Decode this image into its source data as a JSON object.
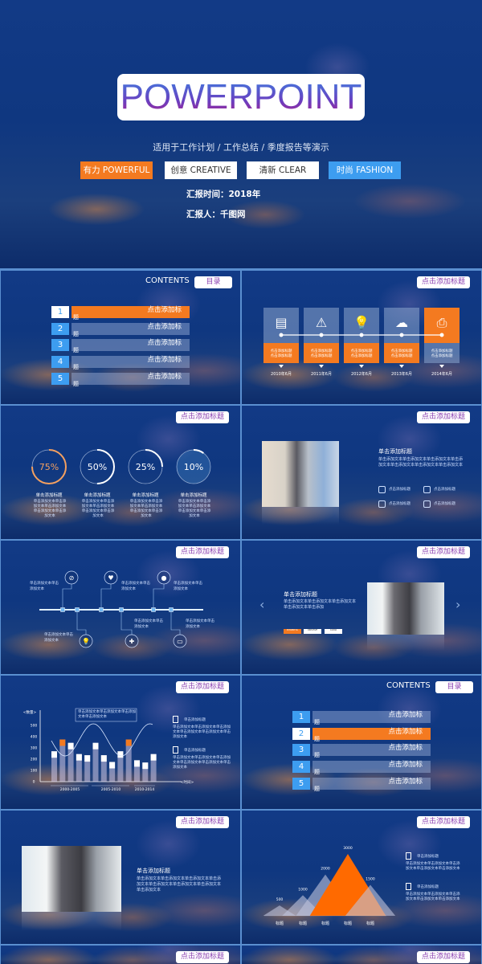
{
  "cover": {
    "title": "POWERPOINT",
    "subtitle": "适用于工作计划 / 工作总结 / 季度报告等演示",
    "tags": [
      {
        "label": "有力 POWERFUL",
        "bg": "#f47a20",
        "fg": "#ffffff"
      },
      {
        "label": "创意 CREATIVE",
        "bg": "#ffffff",
        "fg": "#333333"
      },
      {
        "label": "清新 CLEAR",
        "bg": "#ffffff",
        "fg": "#333333"
      },
      {
        "label": "时尚 FASHION",
        "bg": "#3d9df0",
        "fg": "#ffffff"
      }
    ],
    "report_time": "汇报时间：2018年",
    "reporter": "汇报人：千图网"
  },
  "colors": {
    "accent_orange": "#f47a20",
    "accent_blue": "#3d9df0",
    "title_purple": "#8a3fb0"
  },
  "header_button": "点击添加标题",
  "contents": {
    "label": "CONTENTS",
    "button": "目录",
    "item_text_a": "点击添加标",
    "item_text_b": "题",
    "numbers": [
      "1",
      "2",
      "3",
      "4",
      "5"
    ]
  },
  "timeline": {
    "icons": [
      "notebook-icon",
      "warning-icon",
      "lightbulb-icon",
      "cloud-icon",
      "printer-icon"
    ],
    "card_text": "点击添加标题\n点击添加标题",
    "dates": [
      "2010年6月",
      "2011年6月",
      "2012年6月",
      "2013年6月",
      "2014年6月"
    ]
  },
  "progress": {
    "items": [
      {
        "label": "75%",
        "value": 75
      },
      {
        "label": "50%",
        "value": 50
      },
      {
        "label": "25%",
        "value": 25
      },
      {
        "label": "10%",
        "value": 10
      }
    ],
    "title": "单击添加标题",
    "body": "单击添加文本单击添加文本单击添加文本单击添加文本单击添加文本"
  },
  "photo_slide": {
    "title": "单击添加标题",
    "body": "单击添加文本单击添加文本单击添加文本单击添加文本单击添加文本单击添加文本单击添加文本",
    "features": [
      {
        "icon": "camera-icon",
        "label": "点击添加标题"
      },
      {
        "icon": "globe-icon",
        "label": "点击添加标题"
      },
      {
        "icon": "monitor-icon",
        "label": "点击添加标题"
      },
      {
        "icon": "image-icon",
        "label": "点击添加标题"
      }
    ]
  },
  "icon_timeline": {
    "text": "单击添加文本单击添加文本",
    "icons": [
      "compass-icon",
      "heart-icon",
      "chat-icon",
      "lightbulb-icon",
      "plus-icon",
      "ticket-icon"
    ]
  },
  "carousel": {
    "title": "单击添加标题",
    "body": "单击添加文本单击添加文本单击添加文本单击添加文本单击添加",
    "tags": [
      "POWERFUL",
      "CREATIVE",
      "CLEAR"
    ]
  },
  "chart_data": [
    {
      "type": "bar",
      "ylabel": "<数量>",
      "xlabel": "<时间>",
      "ylim": [
        0,
        500
      ],
      "yticks": [
        "0",
        "100",
        "200",
        "300",
        "400",
        "500"
      ],
      "groups": [
        "2000-2005",
        "2005-2010",
        "2010-2014"
      ],
      "values": [
        270,
        375,
        345,
        245,
        235,
        345,
        235,
        175,
        270,
        375,
        190,
        170,
        245
      ],
      "highlight": [
        1,
        9
      ],
      "callout": "单击添加文本单击添加文本单击添加文本单击添加文本",
      "side": [
        {
          "icon": "calculator-icon",
          "title": "单击添加标题",
          "body": "单击添加文本单击添加文本单击添加文本单击添加文本单击添加文本单击添加文本"
        },
        {
          "icon": "phone-icon",
          "title": "单击添加标题",
          "body": "单击添加文本单击添加文本单击添加文本单击添加文本单击添加文本单击添加文本"
        }
      ]
    },
    {
      "type": "area",
      "categories": [
        "标题",
        "标题",
        "标题",
        "标题",
        "标题"
      ],
      "values": [
        500,
        1000,
        2000,
        3000,
        1500
      ],
      "labels": [
        "500",
        "1000",
        "2000",
        "3000",
        "1500"
      ],
      "highlight": [
        3
      ],
      "side": [
        {
          "icon": "calculator-icon",
          "title": "单击添加标题",
          "body": "单击添加文本单击添加文本单击添加文本单击添加文本单击添加文本"
        },
        {
          "icon": "phone-icon",
          "title": "单击添加标题",
          "body": "单击添加文本单击添加文本单击添加文本单击添加文本单击添加文本"
        }
      ]
    }
  ],
  "photo_slide2": {
    "title": "单击添加标题",
    "body": "单击添加文本单击添加文本单击添加文本单击添加文本单击添加文本单击添加文本单击添加文本单击添加文本"
  }
}
